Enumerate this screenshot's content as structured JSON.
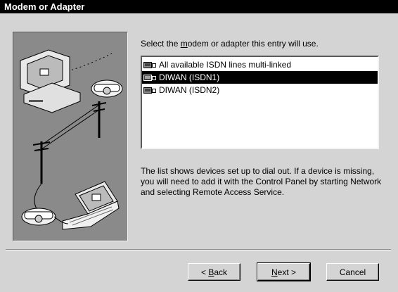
{
  "window": {
    "title": "Modem or Adapter"
  },
  "prompt": {
    "before": "Select the ",
    "underlined": "m",
    "after": "odem or adapter this entry will use."
  },
  "devices": [
    {
      "label": "All available ISDN lines multi-linked",
      "selected": false,
      "icon": "isdn-device-icon"
    },
    {
      "label": "DIWAN (ISDN1)",
      "selected": true,
      "icon": "isdn-device-icon"
    },
    {
      "label": "DIWAN (ISDN2)",
      "selected": false,
      "icon": "isdn-device-icon"
    }
  ],
  "info_text": "The list shows devices set up to dial out.  If a device is missing, you will need to add it with the Control Panel by starting Network and selecting Remote Access Service.",
  "buttons": {
    "back": {
      "prefix": "< ",
      "underlined": "B",
      "rest": "ack"
    },
    "next": {
      "underlined": "N",
      "rest": "ext >"
    },
    "cancel": {
      "label": "Cancel"
    }
  },
  "colors": {
    "selection": "#000000",
    "face": "#d4d4d4",
    "title_bar": "#000000"
  }
}
